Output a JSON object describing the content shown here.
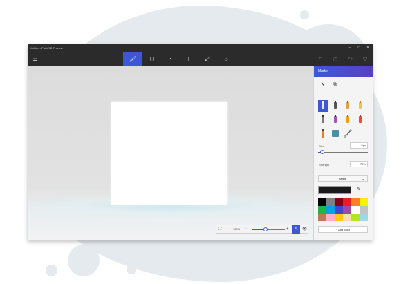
{
  "app": {
    "title": "Untitled - Paint 3D Preview",
    "window_controls": {
      "minimize": "–",
      "maximize": "□",
      "close": "✕"
    }
  },
  "toolbar": {
    "menu_icon": "☰",
    "tools": [
      {
        "name": "brushes",
        "glyph": "🖌",
        "active": true
      },
      {
        "name": "3d-objects",
        "glyph": "⬡",
        "active": false
      },
      {
        "name": "stickers",
        "glyph": "◔",
        "active": false
      },
      {
        "name": "text",
        "glyph": "T",
        "active": false
      },
      {
        "name": "canvas",
        "glyph": "⤢",
        "active": false
      },
      {
        "name": "effects",
        "glyph": "☼",
        "active": false
      }
    ],
    "right": {
      "undo": "↶",
      "history": "◷",
      "redo": "↷",
      "remix": "♡"
    }
  },
  "panel": {
    "title": "Marker",
    "select_icons": {
      "select": "⬉",
      "copy": "⧉"
    },
    "size": {
      "label": "Size",
      "value": "5px",
      "fraction": 0.05
    },
    "strength": {
      "label": "Strength",
      "value": "75%"
    },
    "finish": {
      "value": "Matte"
    },
    "current_color": "#1a1a1a",
    "palette": [
      "#000000",
      "#7f7f7f",
      "#880015",
      "#ed1c24",
      "#ff7f27",
      "#fff200",
      "#22b14c",
      "#00a2e8",
      "#3f48cc",
      "#a349a4",
      "#ffffff",
      "#c3c3c3",
      "#b97a57",
      "#ffaec9",
      "#ffc90e",
      "#efe4b0",
      "#b5e61d",
      "#99d9ea"
    ],
    "add_color": "+ Add color"
  },
  "zoom": {
    "value": "100%",
    "fraction": 0.35
  }
}
